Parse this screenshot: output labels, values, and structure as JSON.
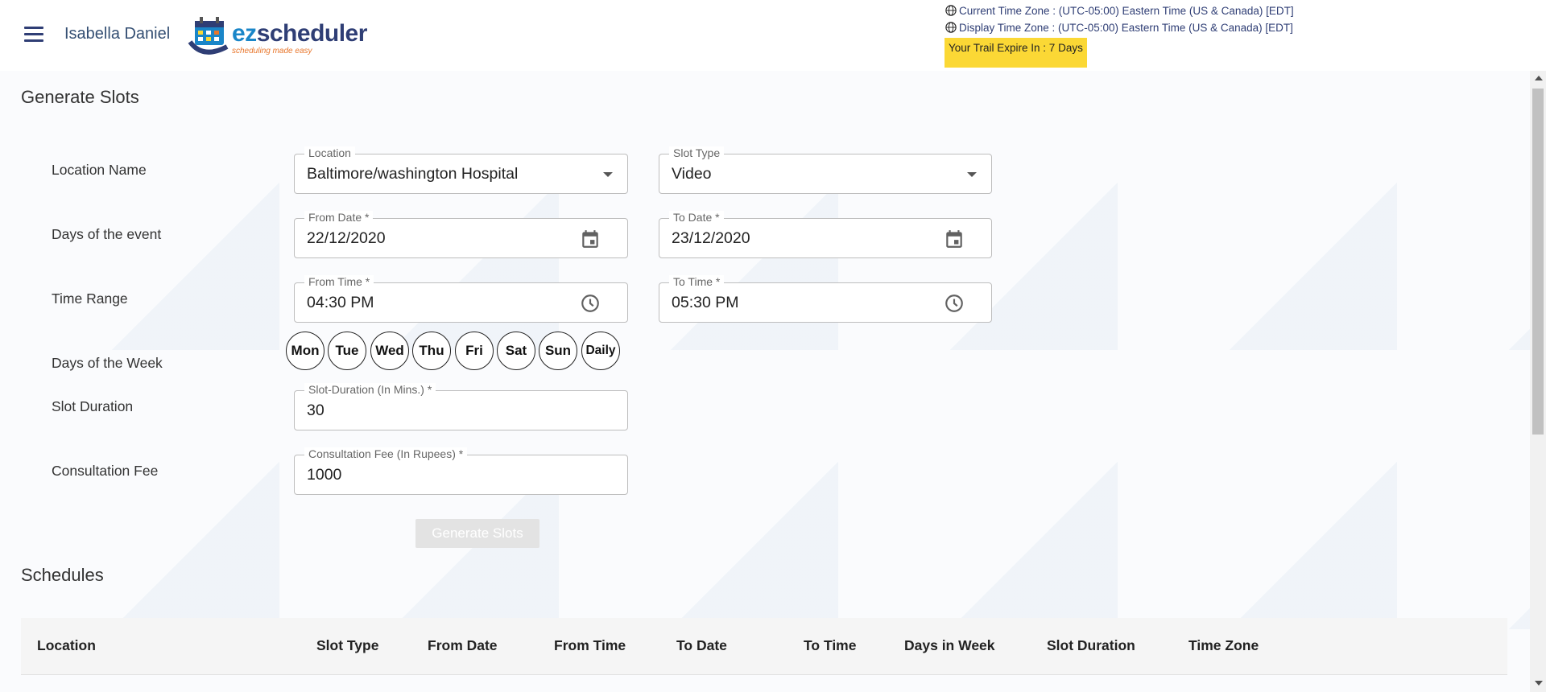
{
  "header": {
    "user_name": "Isabella Daniel",
    "logo_text_a": "ez",
    "logo_text_b": "scheduler",
    "logo_tagline": "scheduling made easy",
    "current_tz": "Current Time Zone : (UTC-05:00) Eastern Time (US & Canada) [EDT]",
    "display_tz": "Display Time Zone : (UTC-05:00) Eastern Time (US & Canada) [EDT]",
    "trial": "Your Trail Expire In : 7 Days"
  },
  "form": {
    "title": "Generate Slots",
    "labels": {
      "location_name": "Location Name",
      "days_of_event": "Days of the event",
      "time_range": "Time Range",
      "days_of_week": "Days of the Week",
      "slot_duration": "Slot Duration",
      "consultation_fee": "Consultation Fee"
    },
    "location": {
      "label": "Location",
      "value": "Baltimore/washington Hospital"
    },
    "slot_type": {
      "label": "Slot Type",
      "value": "Video"
    },
    "from_date": {
      "label": "From Date *",
      "value": "22/12/2020"
    },
    "to_date": {
      "label": "To Date *",
      "value": "23/12/2020"
    },
    "from_time": {
      "label": "From Time *",
      "value": "04:30 PM"
    },
    "to_time": {
      "label": "To Time *",
      "value": "05:30 PM"
    },
    "days": [
      "Mon",
      "Tue",
      "Wed",
      "Thu",
      "Fri",
      "Sat",
      "Sun",
      "Daily"
    ],
    "slot_duration": {
      "label": "Slot-Duration (In Mins.) *",
      "value": "30"
    },
    "consultation_fee": {
      "label": "Consultation Fee (In Rupees) *",
      "value": "1000"
    },
    "generate_button": "Generate Slots"
  },
  "schedules": {
    "title": "Schedules",
    "columns": [
      "Location",
      "Slot Type",
      "From Date",
      "From Time",
      "To Date",
      "To Time",
      "Days in Week",
      "Slot Duration",
      "Time Zone"
    ]
  },
  "colors": {
    "primary": "#2f3e75",
    "trial_bg": "#fbd835",
    "logo_orange": "#e8762b"
  }
}
